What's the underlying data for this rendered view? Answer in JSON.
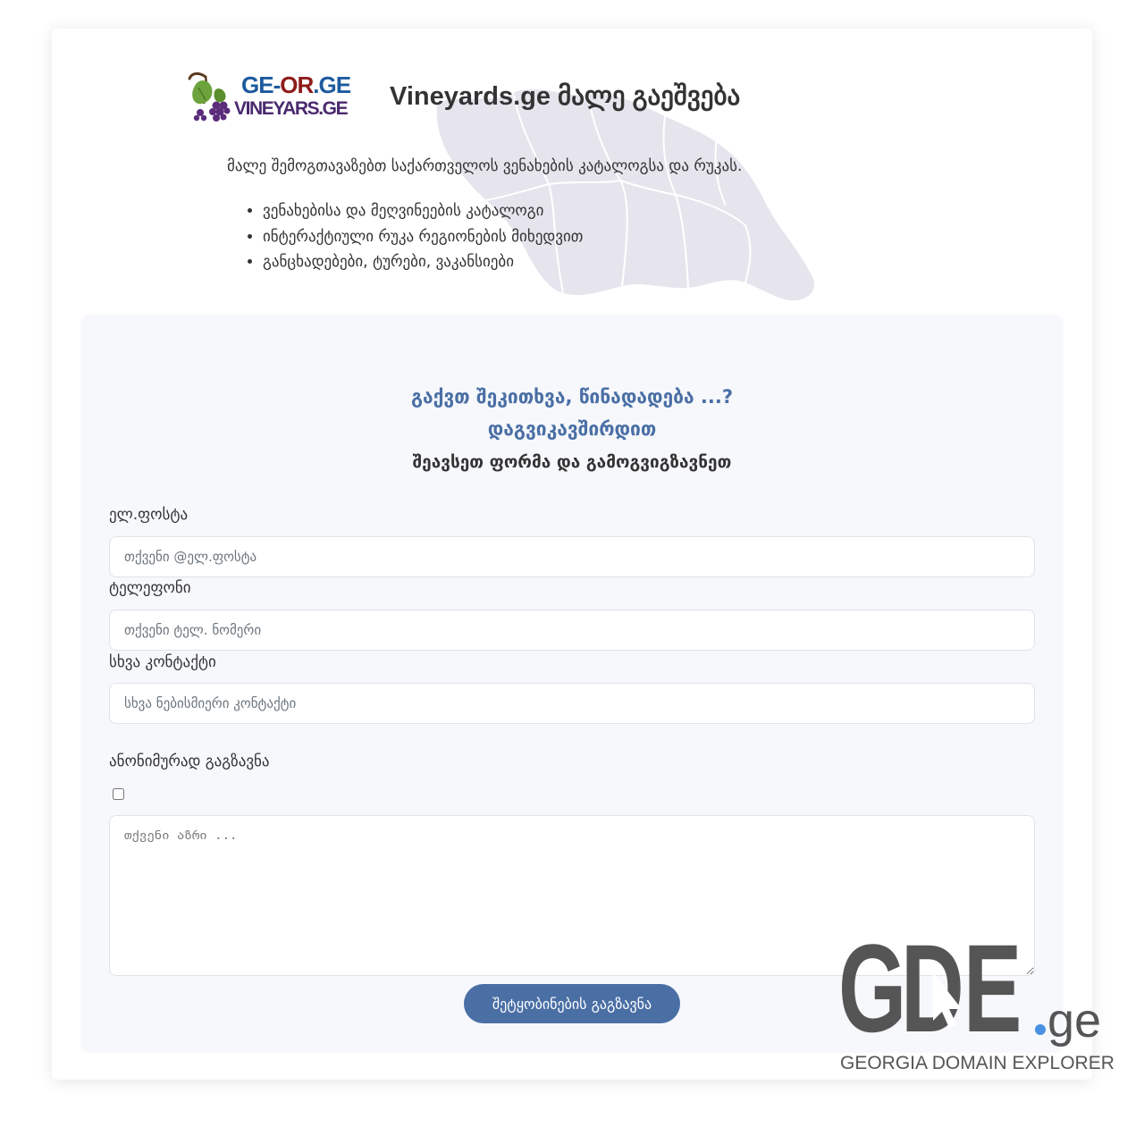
{
  "logo": {
    "part_ge": "GE",
    "part_dash": "-",
    "part_or": "OR",
    "part_dotge": ".GE",
    "subtitle": "VINEYARS.GE",
    "icon": "grape-vine-icon"
  },
  "header": {
    "title": "Vineyards.ge მალე გაეშვება",
    "intro": "მალე შემოგთავაზებთ საქართველოს ვენახების კატალოგსა და რუკას.",
    "features": [
      "ვენახებისა და მეღვინეების კატალოგი",
      "ინტერაქტიული რუკა რეგიონების მიხედვით",
      "განცხადებები, ტურები, ვაკანსიები"
    ],
    "background_icon": "georgia-map-icon"
  },
  "contact": {
    "heading_line1": "გაქვთ შეკითხვა, წინადადება ...?",
    "heading_line2": "დაგვიკავშირდით",
    "form_title": "შეავსეთ ფორმა და გამოგვიგზავნეთ",
    "email": {
      "label": "ელ.ფოსტა",
      "placeholder": "თქვენი @ელ.ფოსტა",
      "value": ""
    },
    "phone": {
      "label": "ტელეფონი",
      "placeholder": "თქვენი ტელ. ნომერი",
      "value": ""
    },
    "other": {
      "label": "სხვა კონტაქტი",
      "placeholder": "სხვა ნებისმიერი კონტაქტი",
      "value": ""
    },
    "anonymous": {
      "label": "ანონიმურად გაგზავნა",
      "checked": false
    },
    "message": {
      "placeholder": "თქვენი აზრი ...",
      "value": ""
    },
    "submit_label": "შეტყობინების გაგზავნა"
  },
  "watermark": {
    "letters_g": "G",
    "letters_d": "D",
    "letters_e": "E",
    "tld": ".ge",
    "caption": "GEORGIA DOMAIN EXPLORER",
    "icon": "cursor-arrow-icon"
  },
  "colors": {
    "accent": "#4a6fa5",
    "logo_blue": "#1c5a9e",
    "logo_red": "#8e1b1b",
    "logo_purple": "#4a2a6e",
    "panel_bg": "#f6f8fb",
    "watermark_gray": "#555555",
    "watermark_dot": "#4a90e2"
  }
}
